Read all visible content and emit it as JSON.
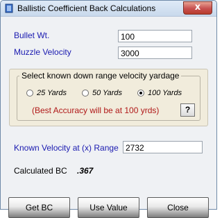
{
  "window": {
    "title": "Ballistic Coefficient  Back Calculations",
    "close_glyph": "x"
  },
  "form": {
    "bullet_wt_label": "Bullet Wt.",
    "bullet_wt_value": "100",
    "muzzle_velocity_label": "Muzzle Velocity",
    "muzzle_velocity_value": "3000"
  },
  "yardage_group": {
    "caption": "Select known down range velocity yardage",
    "options": [
      {
        "label": "25 Yards",
        "checked": false
      },
      {
        "label": "50 Yards",
        "checked": false
      },
      {
        "label": "100 Yards",
        "checked": true
      }
    ],
    "note": "(Best Accuracy will be at 100 yrds)",
    "help_label": "?"
  },
  "known_velocity": {
    "label": "Known Velocity at (x) Range",
    "value": "2732"
  },
  "result": {
    "label": "Calculated BC",
    "value": ".367"
  },
  "buttons": {
    "get_bc": "Get BC",
    "use_value": "Use Value",
    "close": "Close"
  },
  "colors": {
    "label_blue": "#1a1ab0",
    "note_red": "#b01818",
    "group_background": "#f1ecdc"
  }
}
